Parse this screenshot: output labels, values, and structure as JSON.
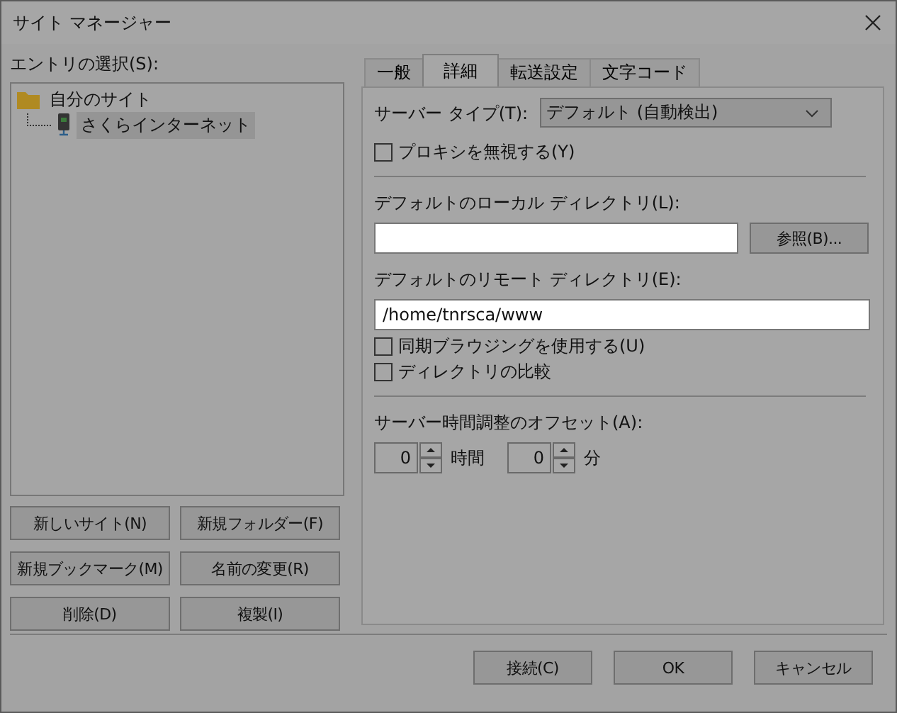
{
  "window": {
    "title": "サイト マネージャー"
  },
  "entries": {
    "label": "エントリの選択(S):",
    "tree": [
      {
        "label": "自分のサイト",
        "kind": "folder",
        "selected": false,
        "children": [
          {
            "label": "さくらインターネット",
            "kind": "site",
            "selected": true
          }
        ]
      }
    ]
  },
  "entry_buttons": [
    "新しいサイト(N)",
    "新規フォルダー(F)",
    "新規ブックマーク(M)",
    "名前の変更(R)",
    "削除(D)",
    "複製(I)"
  ],
  "tabs": [
    {
      "label": "一般",
      "selected": false
    },
    {
      "label": "詳細",
      "selected": true
    },
    {
      "label": "転送設定",
      "selected": false
    },
    {
      "label": "文字コード",
      "selected": false
    }
  ],
  "advanced": {
    "server_type": {
      "label": "サーバー タイプ(T):",
      "value": "デフォルト (自動検出)"
    },
    "bypass_proxy": {
      "label": "プロキシを無視する(Y)",
      "checked": false
    },
    "local_dir": {
      "label": "デフォルトのローカル ディレクトリ(L):",
      "browse": "参照(B)..."
    },
    "remote_dir": {
      "label": "デフォルトのリモート ディレクトリ(E):",
      "value": "/home/tnrsca/www"
    },
    "sync_browsing": {
      "label": "同期ブラウジングを使用する(U)",
      "checked": false
    },
    "compare_dirs": {
      "label": "ディレクトリの比較",
      "checked": false
    },
    "offset": {
      "label": "サーバー時間調整のオフセット(A):",
      "hours": "0",
      "hours_unit": "時間",
      "minutes": "0",
      "minutes_unit": "分"
    }
  },
  "footer_buttons": [
    "接続(C)",
    "OK",
    "キャンセル"
  ]
}
